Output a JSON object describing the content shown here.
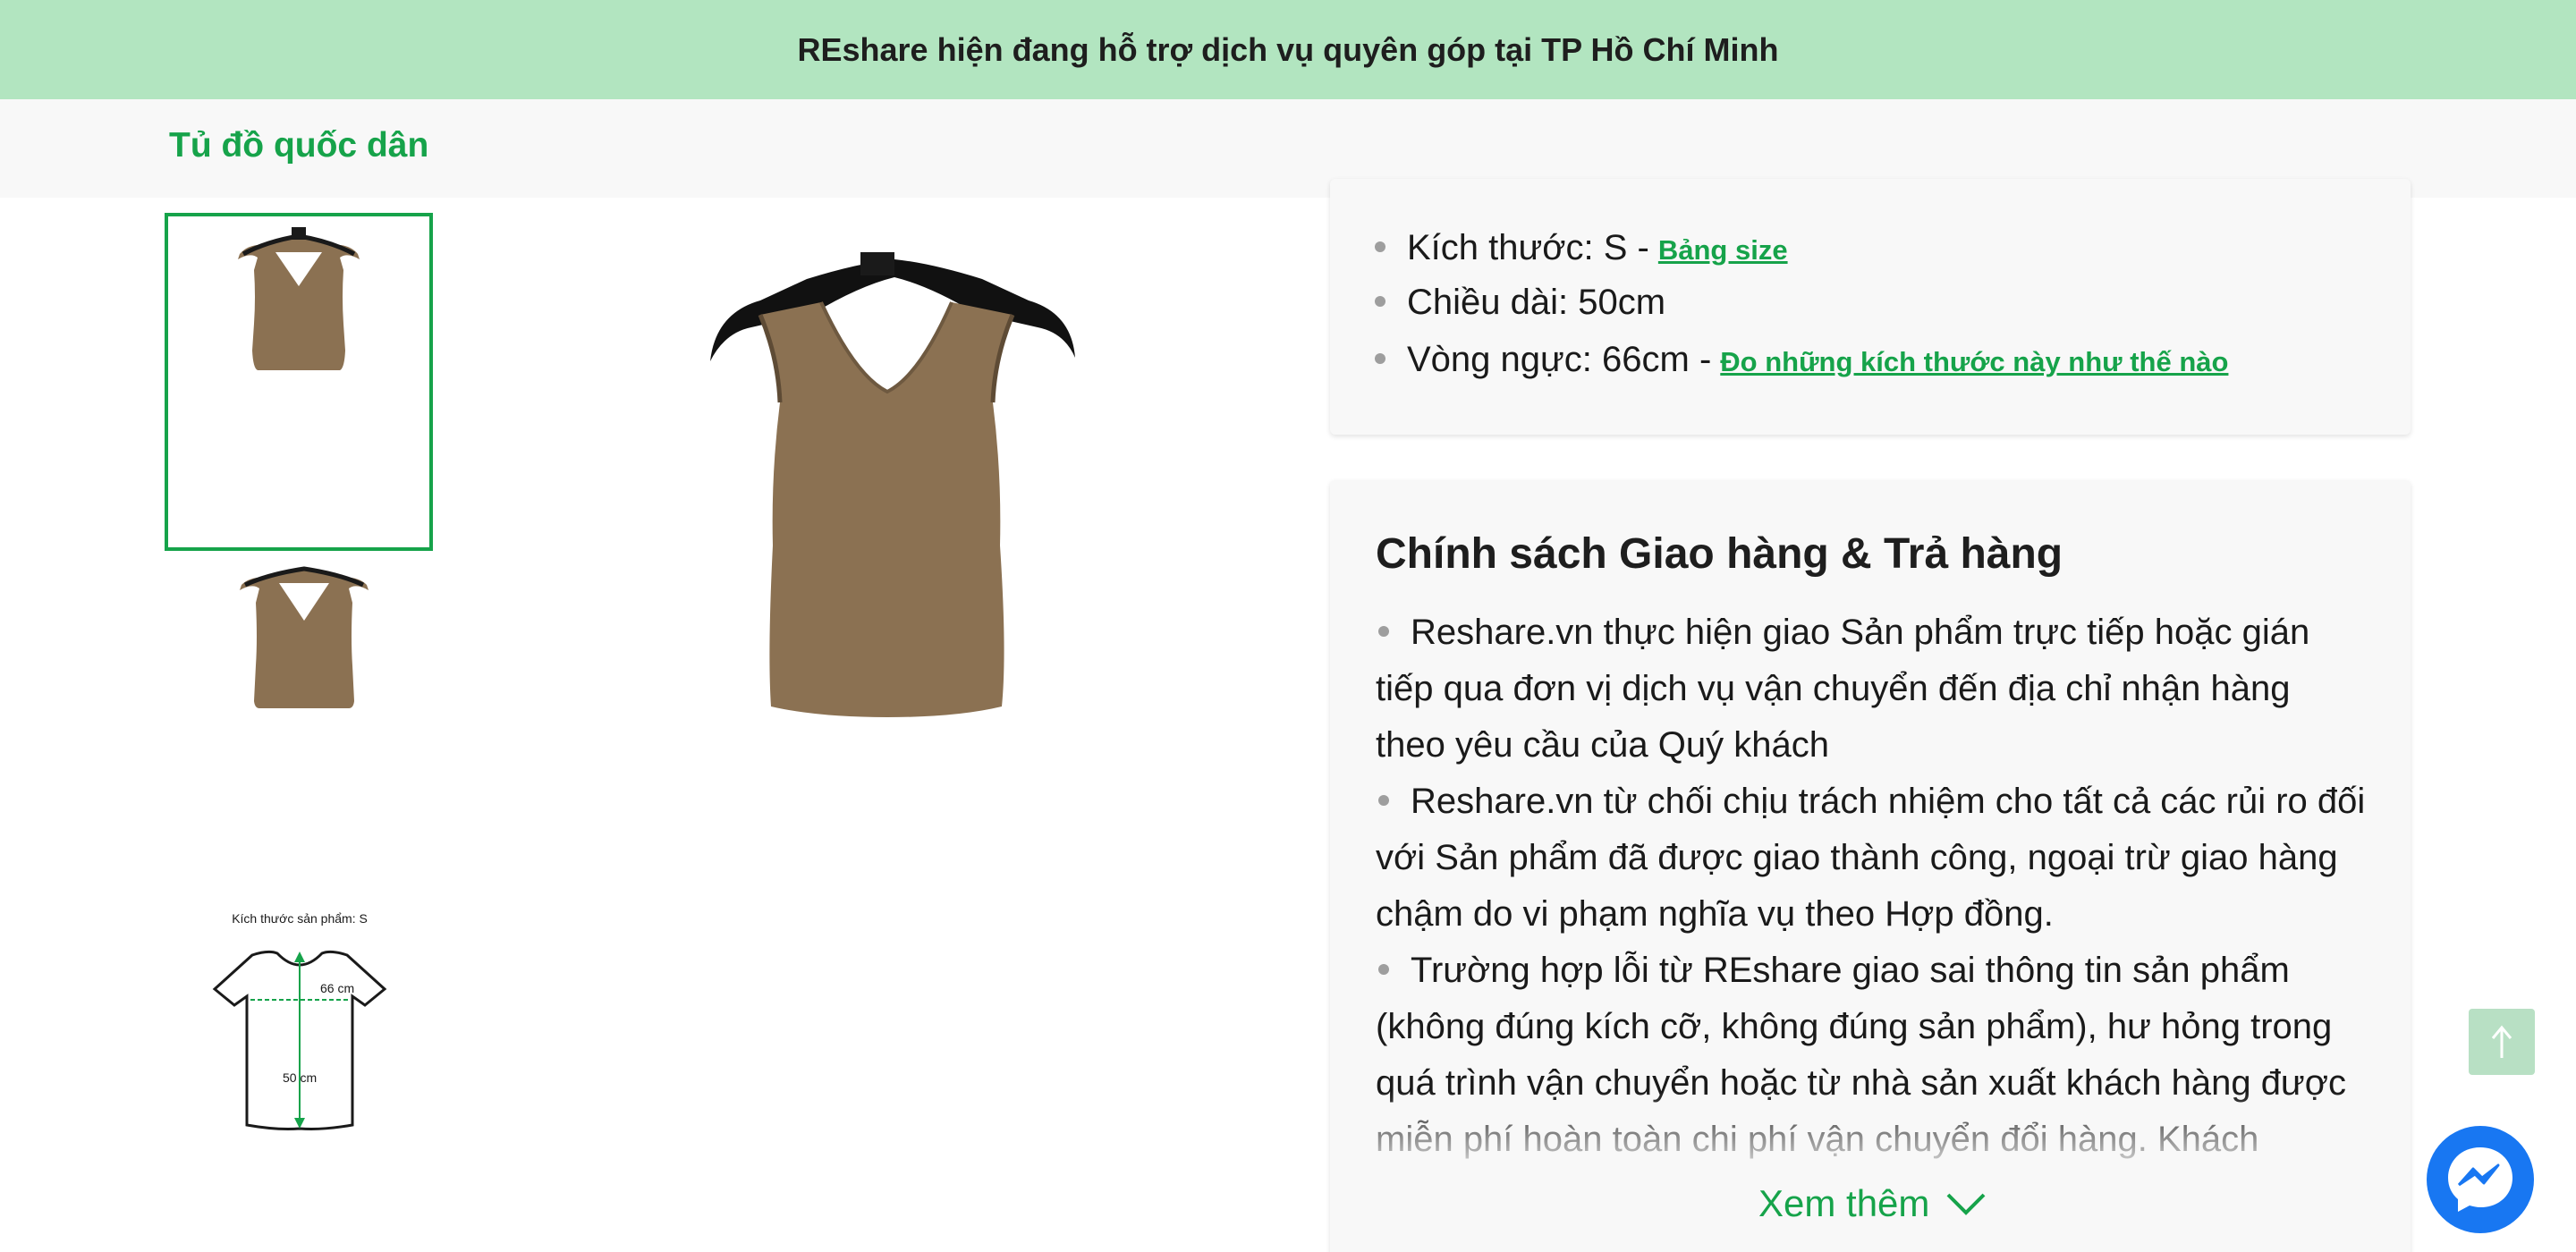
{
  "announcement": "REshare hiện đang hỗ trợ dịch vụ quyên góp tại TP Hồ Chí Minh",
  "brand": "Tủ đồ quốc dân",
  "size_chart": {
    "title": "Kích thước sản phẩm: S",
    "chest": "66 cm",
    "length": "50 cm"
  },
  "specs": {
    "size_label": "Kích thước: S - ",
    "size_link": "Bảng size",
    "length": "Chiều dài: 50cm",
    "chest_label": "Vòng ngực: 66cm - ",
    "chest_link": "Đo những kích thước này như thế nào"
  },
  "policy": {
    "title": "Chính sách Giao hàng & Trả hàng",
    "items": [
      "Reshare.vn thực hiện giao Sản phẩm trực tiếp hoặc gián tiếp qua đơn vị dịch vụ vận chuyển đến địa chỉ nhận hàng theo yêu cầu của Quý khách",
      "Reshare.vn từ chối chịu trách nhiệm cho tất cả các rủi ro đối với Sản phẩm đã được giao thành công, ngoại trừ giao hàng chậm do vi phạm nghĩa vụ theo Hợp đồng.",
      "Trường hợp lỗi từ REshare giao sai thông tin sản phẩm (không đúng kích cỡ, không đúng sản phẩm), hư hỏng trong quá trình vận chuyển hoặc từ nhà sản xuất khách hàng được miễn phí hoàn toàn chi phí vận chuyển đổi hàng. Khách"
    ],
    "more_label": "Xem thêm"
  },
  "colors": {
    "accent": "#16a34a",
    "banner": "#b2e5c0",
    "product": "#8b7152"
  },
  "icons": {
    "to_top": "arrow-up-icon",
    "messenger": "messenger-icon",
    "more": "chevron-down-icon"
  }
}
